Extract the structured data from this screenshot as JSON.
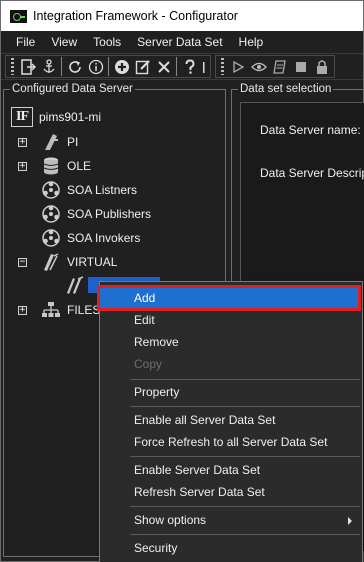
{
  "window": {
    "title": "Integration Framework - Configurator"
  },
  "menubar": {
    "items": [
      "File",
      "View",
      "Tools",
      "Server Data Set",
      "Help"
    ]
  },
  "left_panel": {
    "title": "Configured Data Server",
    "root_logo": "IF",
    "tree": {
      "root": "pims901-mi",
      "items": [
        {
          "label": "PI",
          "icon": "pi-icon",
          "expander": "+"
        },
        {
          "label": "OLE",
          "icon": "database-icon",
          "expander": "+"
        },
        {
          "label": "SOA Listners",
          "icon": "soa-listner-icon"
        },
        {
          "label": "SOA Publishers",
          "icon": "soa-publisher-icon"
        },
        {
          "label": "SOA Invokers",
          "icon": "soa-invoker-icon"
        },
        {
          "label": "VIRTUAL",
          "icon": "virtual-icon",
          "expander": "−"
        },
        {
          "label": "",
          "icon": "virtual-child-icon"
        },
        {
          "label": "FILESY",
          "icon": "filesystem-icon",
          "expander": "+"
        }
      ]
    }
  },
  "right_panel": {
    "title": "Data set selection",
    "data_server_name_label": "Data Server name:",
    "data_server_desc_label": "Data Server Descript"
  },
  "context_menu": {
    "items": [
      {
        "label": "Add",
        "state": "highlighted"
      },
      {
        "label": "Edit"
      },
      {
        "label": "Remove"
      },
      {
        "label": "Copy",
        "state": "disabled"
      },
      {
        "label": "Property"
      },
      {
        "label": "Enable all Server Data Set"
      },
      {
        "label": "Force Refresh to all Server Data Set"
      },
      {
        "label": "Enable Server Data Set"
      },
      {
        "label": "Refresh Server Data Set"
      },
      {
        "label": "Show options",
        "submenu": true
      },
      {
        "label": "Security"
      }
    ]
  },
  "colors": {
    "selection": "#1f6fd0",
    "highlight_outline": "#e02020",
    "background": "#202020"
  }
}
